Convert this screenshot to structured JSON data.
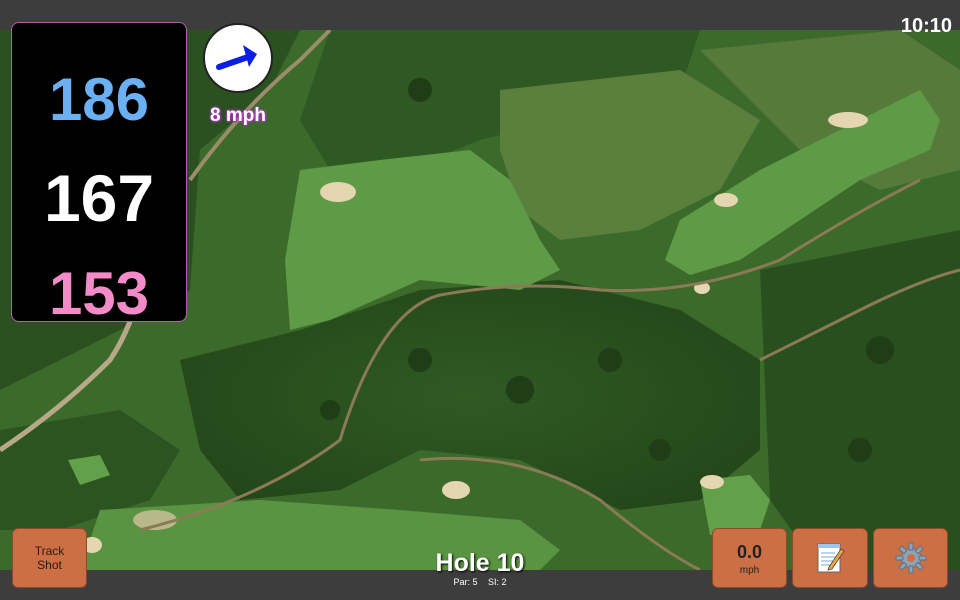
{
  "status_bar": {
    "time": "10:10"
  },
  "distances": {
    "back": "186",
    "center": "167",
    "front": "153",
    "colors": {
      "back": "#6ab0f3",
      "center": "#ffffff",
      "front": "#f48bc9"
    }
  },
  "wind": {
    "speed_label": "8 mph",
    "direction_icon": "arrow-right-icon",
    "arrow_color": "#0a1fe0"
  },
  "hole": {
    "title": "Hole 10",
    "par_label": "Par: 5",
    "si_label": "SI: 2"
  },
  "buttons": {
    "track_shot": {
      "line1": "Track",
      "line2": "Shot"
    },
    "speed": {
      "value": "0.0",
      "unit": "mph"
    },
    "notes_icon": "memo-icon",
    "settings_icon": "gear-icon"
  },
  "colors": {
    "button_fill": "#cd6f45",
    "bar": "#3d3d3d",
    "panel_border": "#b060b0"
  }
}
